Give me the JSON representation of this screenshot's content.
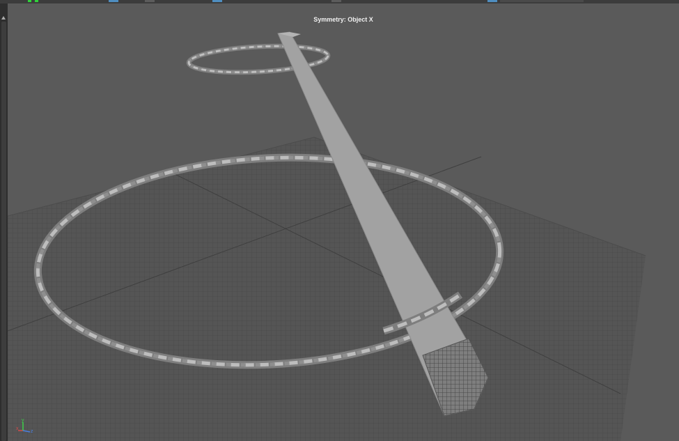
{
  "viewport": {
    "hud": {
      "symmetry_label": "Symmetry: Object X"
    },
    "axis_gizmo": {
      "x_label": "x",
      "y_label": "y",
      "z_label": "z",
      "x_color": "#d24b4b",
      "y_color": "#3fd24b",
      "z_color": "#4a7fe0"
    }
  },
  "colors": {
    "viewport_bg": "#5a5a5a",
    "grid_line": "#4a4a4a",
    "mesh": "#a6a6a6",
    "toolbar_bg": "#3c3c3c"
  },
  "icons": [
    "scroll-up-icon",
    "axis-gizmo-icon"
  ]
}
